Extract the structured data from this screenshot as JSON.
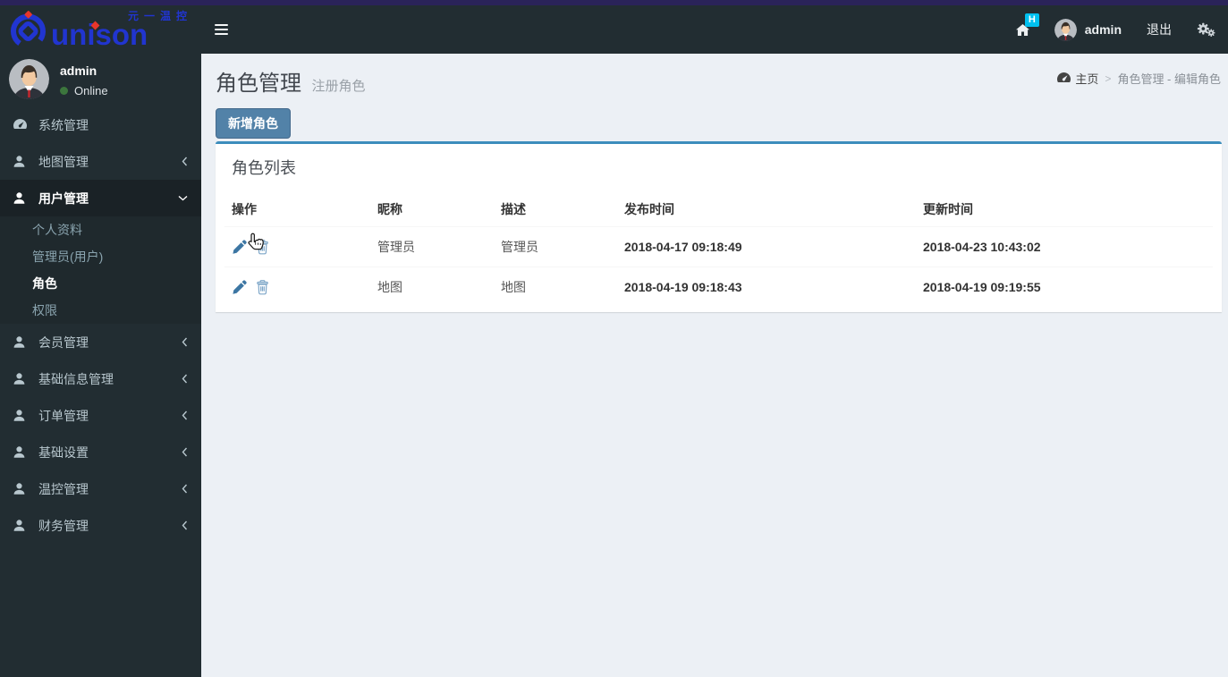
{
  "brand": {
    "name": "unison",
    "tagline": "元一温控"
  },
  "navbar": {
    "username": "admin",
    "logout_label": "退出",
    "home_badge": "H"
  },
  "sidebar": {
    "user": {
      "name": "admin",
      "status": "Online"
    },
    "menu": [
      {
        "label": "系统管理"
      },
      {
        "label": "地图管理"
      },
      {
        "label": "用户管理",
        "children": [
          {
            "label": "个人资料"
          },
          {
            "label": "管理员(用户)"
          },
          {
            "label": "角色"
          },
          {
            "label": "权限"
          }
        ]
      },
      {
        "label": "会员管理"
      },
      {
        "label": "基础信息管理"
      },
      {
        "label": "订单管理"
      },
      {
        "label": "基础设置"
      },
      {
        "label": "温控管理"
      },
      {
        "label": "财务管理"
      }
    ]
  },
  "page": {
    "title": "角色管理",
    "subtitle": "注册角色",
    "breadcrumb": {
      "home": "主页",
      "separator": ">",
      "current": "角色管理 - 编辑角色"
    },
    "add_button_label": "新增角色",
    "box_title": "角色列表"
  },
  "table": {
    "headers": [
      "操作",
      "昵称",
      "描述",
      "发布时间",
      "更新时间"
    ],
    "rows": [
      {
        "nickname": "管理员",
        "description": "管理员",
        "published_at": "2018-04-17 09:18:49",
        "updated_at": "2018-04-23 10:43:02"
      },
      {
        "nickname": "地图",
        "description": "地图",
        "published_at": "2018-04-19 09:18:43",
        "updated_at": "2018-04-19 09:19:55"
      }
    ]
  },
  "colors": {
    "top_strip": "#2a2359",
    "dark_bg": "#222d32",
    "accent_blue": "#3c8dbc",
    "button_blue": "#5282a8",
    "brand_blue": "#2135d0",
    "brand_red": "#e8362b",
    "badge_cyan": "#00c0ef",
    "online_green": "#3c763d",
    "content_bg": "#ecf0f5"
  }
}
